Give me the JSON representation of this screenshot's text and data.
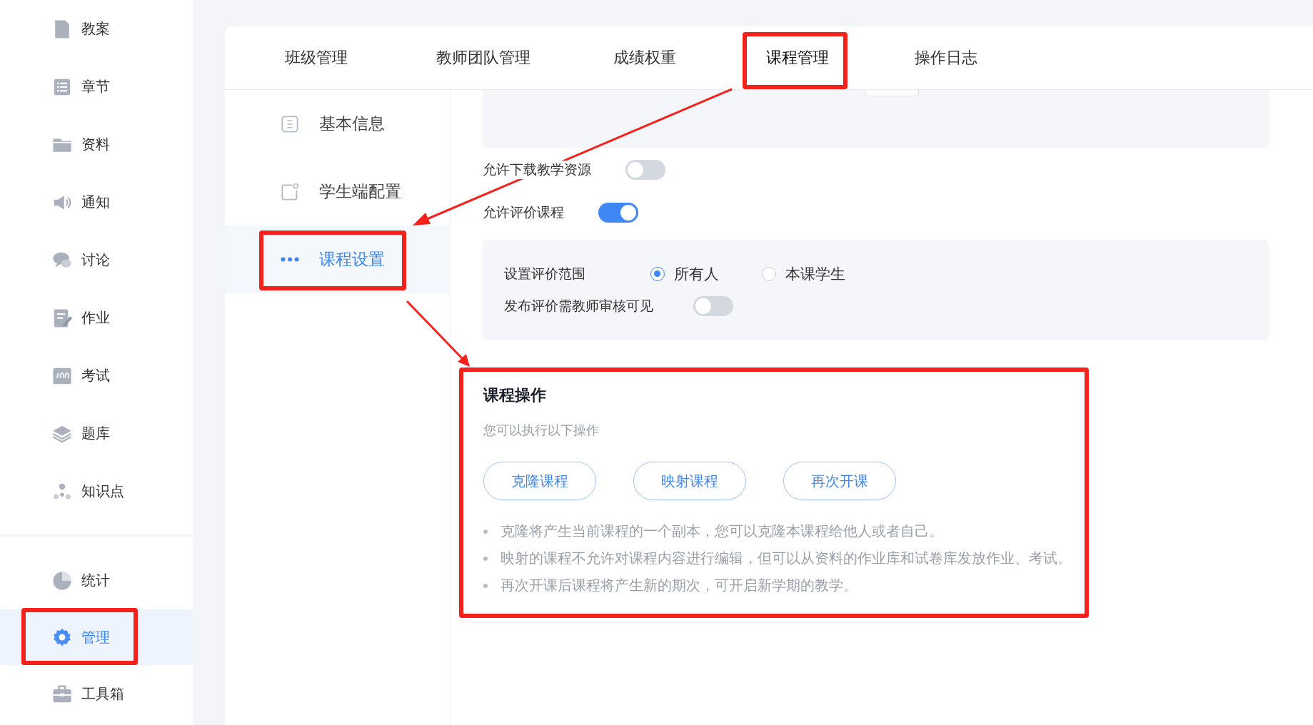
{
  "sidebar": {
    "sections": [
      {
        "items": [
          {
            "label": "教案",
            "selected": false
          },
          {
            "label": "章节",
            "selected": false
          },
          {
            "label": "资料",
            "selected": false
          },
          {
            "label": "通知",
            "selected": false
          },
          {
            "label": "讨论",
            "selected": false
          },
          {
            "label": "作业",
            "selected": false
          },
          {
            "label": "考试",
            "selected": false
          },
          {
            "label": "题库",
            "selected": false
          },
          {
            "label": "知识点",
            "selected": false
          }
        ]
      },
      {
        "items": [
          {
            "label": "统计",
            "selected": false
          },
          {
            "label": "管理",
            "selected": true
          },
          {
            "label": "工具箱",
            "selected": false
          }
        ]
      }
    ]
  },
  "tabs": [
    {
      "label": "班级管理",
      "selected": false
    },
    {
      "label": "教师团队管理",
      "selected": false
    },
    {
      "label": "成绩权重",
      "selected": false
    },
    {
      "label": "课程管理",
      "selected": true
    },
    {
      "label": "操作日志",
      "selected": false
    }
  ],
  "subnav": [
    {
      "label": "基本信息",
      "selected": false
    },
    {
      "label": "学生端配置",
      "selected": false
    },
    {
      "label": "课程设置",
      "selected": true
    }
  ],
  "settings": {
    "toggles": [
      {
        "label": "允许下载教学资源",
        "on": false
      },
      {
        "label": "允许评价课程",
        "on": true
      }
    ],
    "review_box": {
      "scope_label": "设置评价范围",
      "options": [
        {
          "label": "所有人",
          "selected": true
        },
        {
          "label": "本课学生",
          "selected": false
        }
      ],
      "approval": {
        "label": "发布评价需教师审核可见",
        "on": false
      }
    }
  },
  "course_operations": {
    "title": "课程操作",
    "subtitle": "您可以执行以下操作",
    "buttons": [
      "克隆课程",
      "映射课程",
      "再次开课"
    ],
    "notes": [
      "克隆将产生当前课程的一个副本，您可以克隆本课程给他人或者自己。",
      "映射的课程不允许对课程内容进行编辑，但可以从资料的作业库和试卷库发放作业、考试。",
      "再次开课后课程将产生新的期次，可开启新学期的教学。"
    ]
  }
}
